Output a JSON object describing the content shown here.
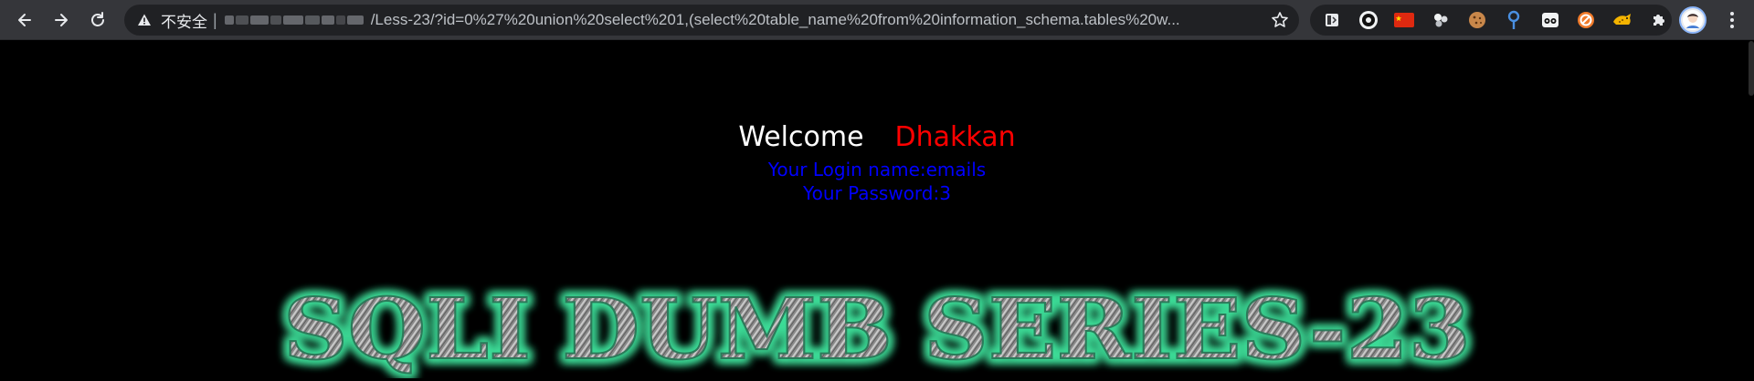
{
  "browser": {
    "security_label": "不安全",
    "separator": "|",
    "url": "/Less-23/?id=0%27%20union%20select%201,(select%20table_name%20from%20information_schema.tables%20w...",
    "icons": {
      "back": "arrow-left-icon",
      "forward": "arrow-right-icon",
      "reload": "reload-icon",
      "warning": "warning-triangle-icon",
      "bookmark": "star-icon",
      "extensions": [
        "sidebar-icon",
        "circle-ring-icon",
        "china-flag-icon",
        "paw-icon",
        "cookie-icon",
        "location-pin-icon",
        "owl-icon",
        "no-sign-icon",
        "cheetah-icon",
        "puzzle-piece-icon"
      ],
      "profile": "avatar-icon",
      "menu": "kebab-menu-icon"
    }
  },
  "page": {
    "welcome": "Welcome",
    "username": "Dhakkan",
    "login_line": "Your Login name:emails",
    "password_line": "Your Password:3",
    "banner_text": "SQLI DUMB SERIES-23"
  },
  "colors": {
    "page_bg": "#000000",
    "welcome": "#ffffff",
    "username": "#ff0000",
    "info": "#0000ff",
    "banner_glow": "#3ddc97",
    "toolbar_bg": "#35363a",
    "omnibox_bg": "#202124"
  }
}
